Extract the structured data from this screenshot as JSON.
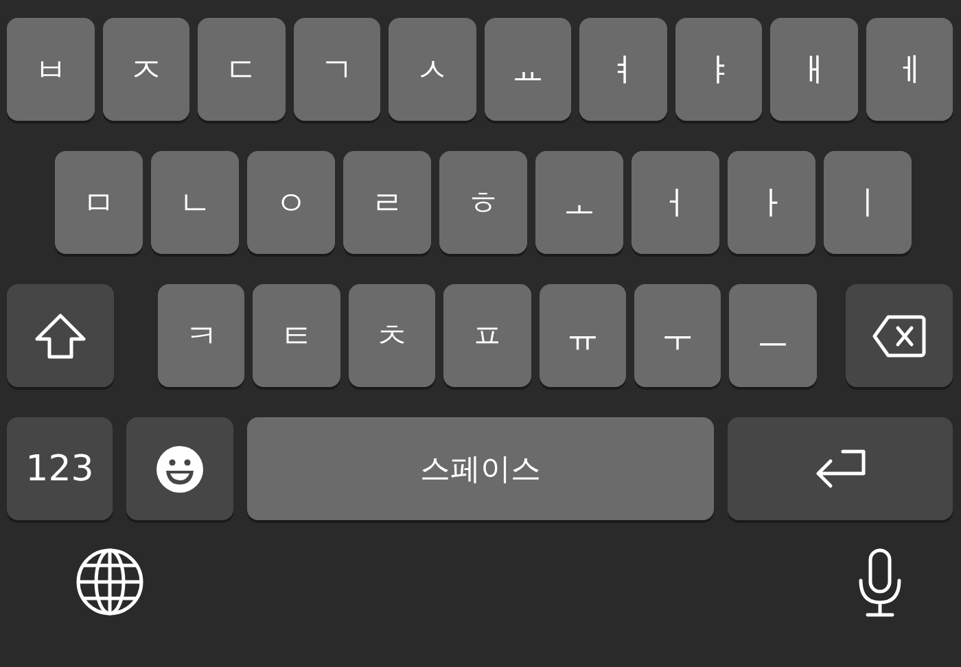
{
  "keyboard": {
    "rows": [
      {
        "keys": [
          {
            "kind": "letter",
            "label": "ㅂ"
          },
          {
            "kind": "letter",
            "label": "ㅈ"
          },
          {
            "kind": "letter",
            "label": "ㄷ"
          },
          {
            "kind": "letter",
            "label": "ㄱ"
          },
          {
            "kind": "letter",
            "label": "ㅅ"
          },
          {
            "kind": "letter",
            "label": "ㅛ"
          },
          {
            "kind": "letter",
            "label": "ㅕ"
          },
          {
            "kind": "letter",
            "label": "ㅑ"
          },
          {
            "kind": "letter",
            "label": "ㅐ"
          },
          {
            "kind": "letter",
            "label": "ㅔ"
          }
        ]
      },
      {
        "keys": [
          {
            "kind": "letter",
            "label": "ㅁ"
          },
          {
            "kind": "letter",
            "label": "ㄴ"
          },
          {
            "kind": "letter",
            "label": "ㅇ"
          },
          {
            "kind": "letter",
            "label": "ㄹ"
          },
          {
            "kind": "letter",
            "label": "ㅎ"
          },
          {
            "kind": "letter",
            "label": "ㅗ"
          },
          {
            "kind": "letter",
            "label": "ㅓ"
          },
          {
            "kind": "letter",
            "label": "ㅏ"
          },
          {
            "kind": "letter",
            "label": "ㅣ"
          }
        ]
      },
      {
        "keys": [
          {
            "kind": "shift"
          },
          {
            "kind": "letter",
            "label": "ㅋ"
          },
          {
            "kind": "letter",
            "label": "ㅌ"
          },
          {
            "kind": "letter",
            "label": "ㅊ"
          },
          {
            "kind": "letter",
            "label": "ㅍ"
          },
          {
            "kind": "letter",
            "label": "ㅠ"
          },
          {
            "kind": "letter",
            "label": "ㅜ"
          },
          {
            "kind": "letter",
            "label": "ㅡ"
          },
          {
            "kind": "backspace"
          }
        ]
      },
      {
        "keys": [
          {
            "kind": "numbers",
            "label": "123"
          },
          {
            "kind": "emoji"
          },
          {
            "kind": "space",
            "label": "스페이스"
          },
          {
            "kind": "return"
          }
        ]
      }
    ]
  }
}
